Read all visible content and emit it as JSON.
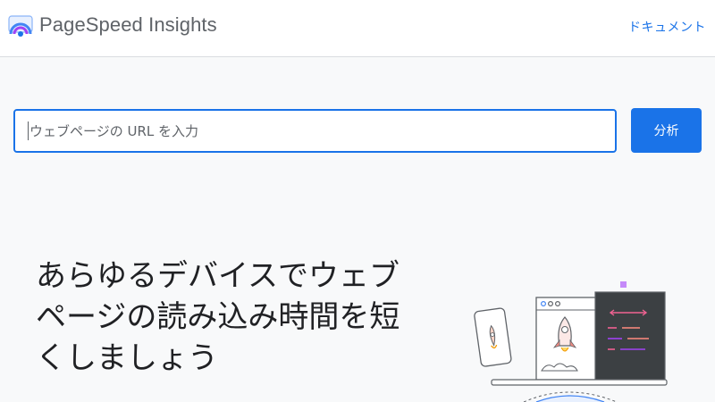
{
  "header": {
    "app_title": "PageSpeed Insights",
    "docs_link": "ドキュメント",
    "logo_icon": "pagespeed-gauge-icon"
  },
  "search": {
    "placeholder": "ウェブページの URL を入力",
    "value": "",
    "analyze_label": "分析"
  },
  "hero": {
    "line1": "あらゆるデバイスでウェブ",
    "line2": "ページの読み込み時間を短",
    "line3": "くしましょう",
    "illustration_icon": "rocket-devices-illustration"
  },
  "colors": {
    "accent": "#1a73e8",
    "background": "#f8f9fa",
    "header_bg": "#ffffff",
    "code_panel": "#3c4043",
    "code_pink": "#f06292",
    "code_purple": "#a142f4"
  }
}
